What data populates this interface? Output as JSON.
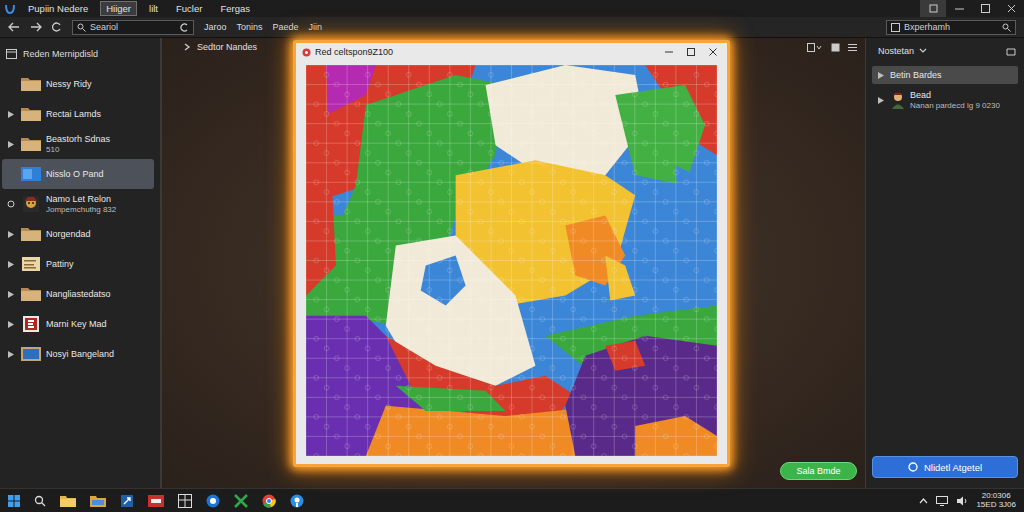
{
  "title_bar": {
    "menus": [
      {
        "label": "Pupiin Nedere",
        "selected": false
      },
      {
        "label": "Hiiger",
        "selected": true
      },
      {
        "label": "lilt",
        "selected": false
      },
      {
        "label": "Fucler",
        "selected": false
      },
      {
        "label": "Fergas",
        "selected": false
      }
    ]
  },
  "toolbar": {
    "search": {
      "value": "Seariol"
    },
    "menus": [
      "Jaroo",
      "Tonins",
      "Paede",
      "Jiin"
    ],
    "right_search": {
      "value": "Bxperhamh"
    }
  },
  "sidebar": {
    "header": "Reden Mernipdisld",
    "items": [
      {
        "label": "Nessy Ridy",
        "kind": "folder",
        "selected": false,
        "expandable": false,
        "marked": false
      },
      {
        "label": "Rectai Lamds",
        "kind": "folder",
        "selected": false,
        "expandable": true,
        "marked": false
      },
      {
        "label": "Beastorh Sdnas",
        "sublabel": "510",
        "kind": "folder",
        "selected": false,
        "expandable": true,
        "marked": false
      },
      {
        "label": "Nisslo O Pand",
        "kind": "blue",
        "selected": true,
        "expandable": false,
        "marked": false
      },
      {
        "label": "Namo Let Relon",
        "sublabel": "Jompemchuthg 832",
        "kind": "avatar",
        "selected": false,
        "expandable": false,
        "marked": true
      },
      {
        "label": "Norgendad",
        "kind": "folder",
        "selected": false,
        "expandable": true,
        "marked": false
      },
      {
        "label": "Pattiny",
        "kind": "note",
        "selected": false,
        "expandable": true,
        "marked": false
      },
      {
        "label": "Nangliastedatso",
        "kind": "folder",
        "selected": false,
        "expandable": true,
        "marked": false
      },
      {
        "label": "Marni Key Mad",
        "kind": "red",
        "selected": false,
        "expandable": true,
        "marked": false
      },
      {
        "label": "Nosyi Bangeland",
        "kind": "tile",
        "selected": false,
        "expandable": true,
        "marked": false
      }
    ]
  },
  "content": {
    "header": "Sedtor Nandes",
    "button": "Sala Bmde"
  },
  "puzzle_window": {
    "title": "Red celtspon9Z100"
  },
  "right_panel": {
    "dropdown": "Nostetan",
    "items": [
      {
        "label": "Betin Bardes",
        "kind": "plain",
        "selected": true,
        "expandable": true
      },
      {
        "label": "Bead",
        "sublabel": "Nanan pardecd lg 9 0230",
        "kind": "avatar",
        "selected": false,
        "expandable": true
      }
    ],
    "button": "Nlidetl Atgetel"
  },
  "taskbar": {
    "clock": {
      "time": "20:0306",
      "date": "15ED 3J06"
    }
  }
}
